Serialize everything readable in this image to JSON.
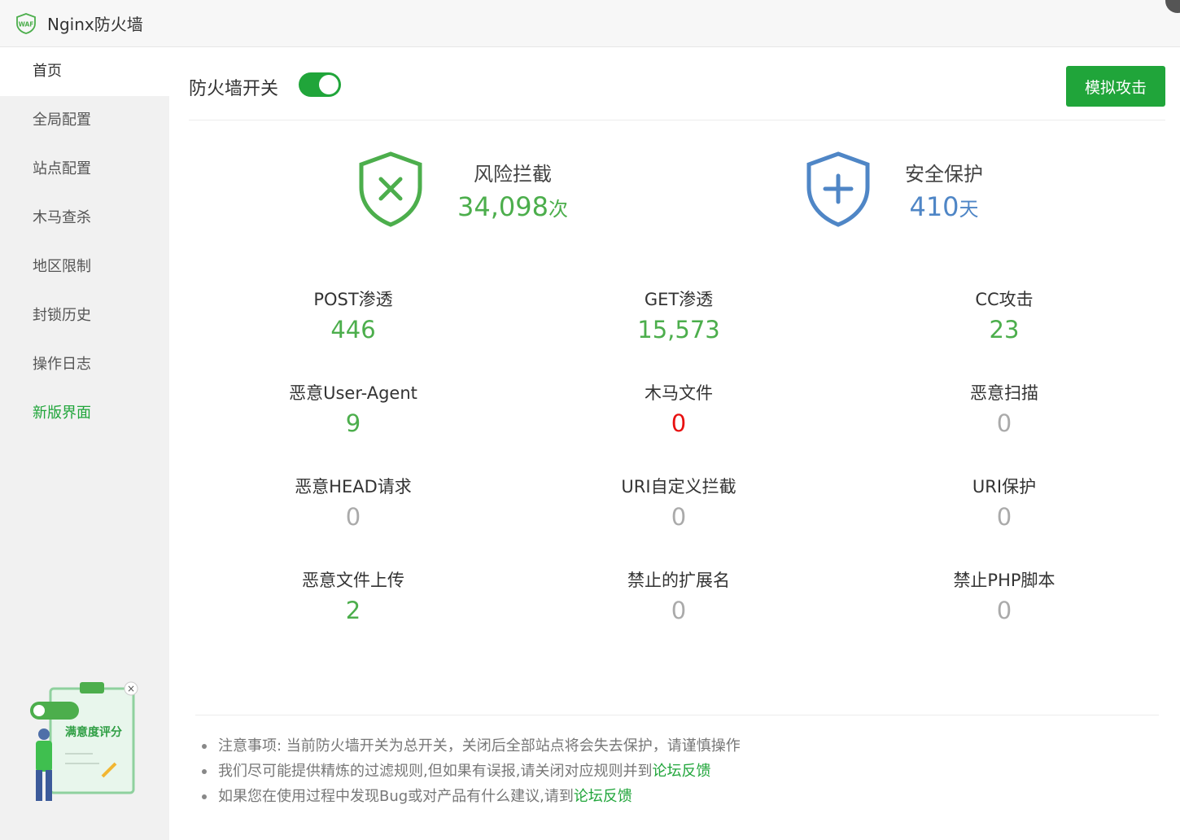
{
  "app": {
    "title": "Nginx防火墙",
    "logo_text": "WAF"
  },
  "sidebar": {
    "items": [
      {
        "label": "首页"
      },
      {
        "label": "全局配置"
      },
      {
        "label": "站点配置"
      },
      {
        "label": "木马查杀"
      },
      {
        "label": "地区限制"
      },
      {
        "label": "封锁历史"
      },
      {
        "label": "操作日志"
      },
      {
        "label": "新版界面"
      }
    ],
    "rating_label": "满意度评分",
    "close_glyph": "×"
  },
  "toolbar": {
    "switch_label": "防火墙开关",
    "switch_on": true,
    "simulate_label": "模拟攻击"
  },
  "summary": {
    "risk": {
      "title": "风险拦截",
      "value": "34,098",
      "unit": "次"
    },
    "safe": {
      "title": "安全保护",
      "value": "410",
      "unit": "天"
    }
  },
  "stats": [
    {
      "label": "POST渗透",
      "value": "446"
    },
    {
      "label": "GET渗透",
      "value": "15,573"
    },
    {
      "label": "CC攻击",
      "value": "23"
    },
    {
      "label": "恶意User-Agent",
      "value": "9"
    },
    {
      "label": "木马文件",
      "value": "0"
    },
    {
      "label": "恶意扫描",
      "value": "0"
    },
    {
      "label": "恶意HEAD请求",
      "value": "0"
    },
    {
      "label": "URI自定义拦截",
      "value": "0"
    },
    {
      "label": "URI保护",
      "value": "0"
    },
    {
      "label": "恶意文件上传",
      "value": "2"
    },
    {
      "label": "禁止的扩展名",
      "value": "0"
    },
    {
      "label": "禁止PHP脚本",
      "value": "0"
    }
  ],
  "notes": {
    "line1": "注意事项: 当前防火墙开关为总开关，关闭后全部站点将会失去保护，请谨慎操作",
    "line2": "我们尽可能提供精炼的过滤规则,但如果有误报,请关闭对应规则并到",
    "line2_link": "论坛反馈",
    "line3": "如果您在使用过程中发现Bug或对产品有什么建议,请到",
    "line3_link": "论坛反馈"
  },
  "colors": {
    "accent": "#20a53a",
    "risk": "#4cae4c",
    "safe": "#4f86c6",
    "danger": "#e81010",
    "muted": "#aaaaaa"
  }
}
